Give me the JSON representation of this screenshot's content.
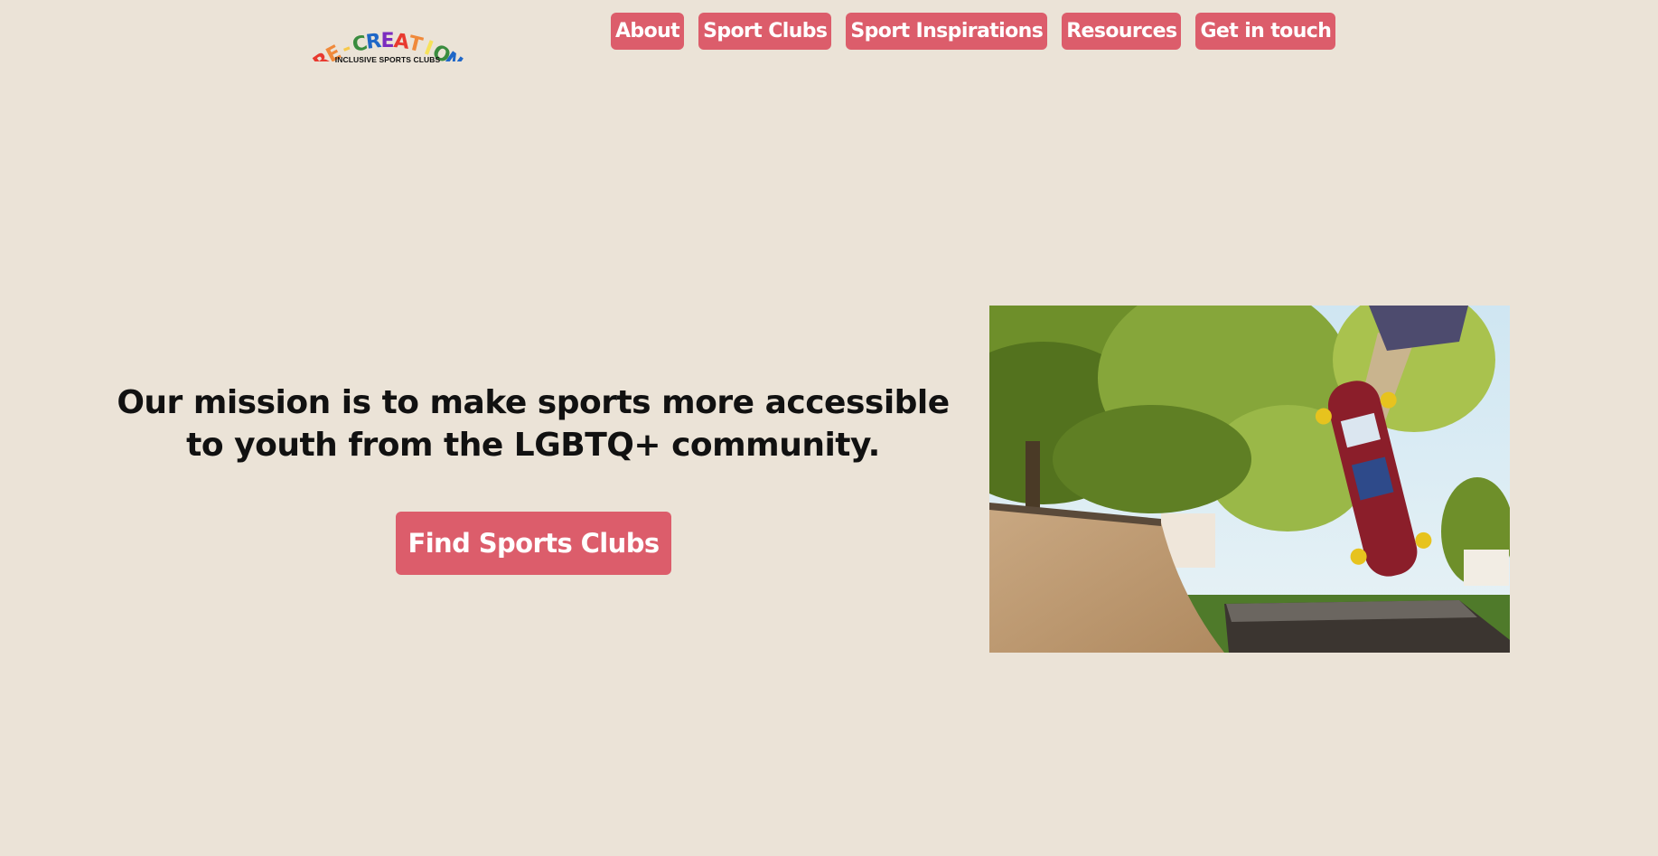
{
  "logo": {
    "letters": [
      "R",
      "E",
      "-",
      "C",
      "R",
      "E",
      "A",
      "T",
      "I",
      "O",
      "N"
    ],
    "letter_colors": [
      "#e8392f",
      "#f0893a",
      "#f7c94a",
      "#3a8c3f",
      "#1f67c7",
      "#7b2cbf",
      "#e8392f",
      "#f0893a",
      "#f7e25a",
      "#3a8c3f",
      "#1f67c7"
    ],
    "tagline": "INCLUSIVE SPORTS CLUBS"
  },
  "nav": {
    "items": [
      {
        "label": "About"
      },
      {
        "label": "Sport Clubs"
      },
      {
        "label": "Sport Inspirations"
      },
      {
        "label": "Resources"
      },
      {
        "label": "Get in touch"
      }
    ]
  },
  "hero": {
    "mission_line1": "Our mission is to make sports more accessible",
    "mission_line2": "to youth from the LGBTQ+ community.",
    "cta_label": "Find Sports Clubs",
    "image_icon": "skateboarder-photo"
  },
  "colors": {
    "background": "#ebe3d7",
    "accent": "#dc5d6b",
    "text": "#111111"
  }
}
